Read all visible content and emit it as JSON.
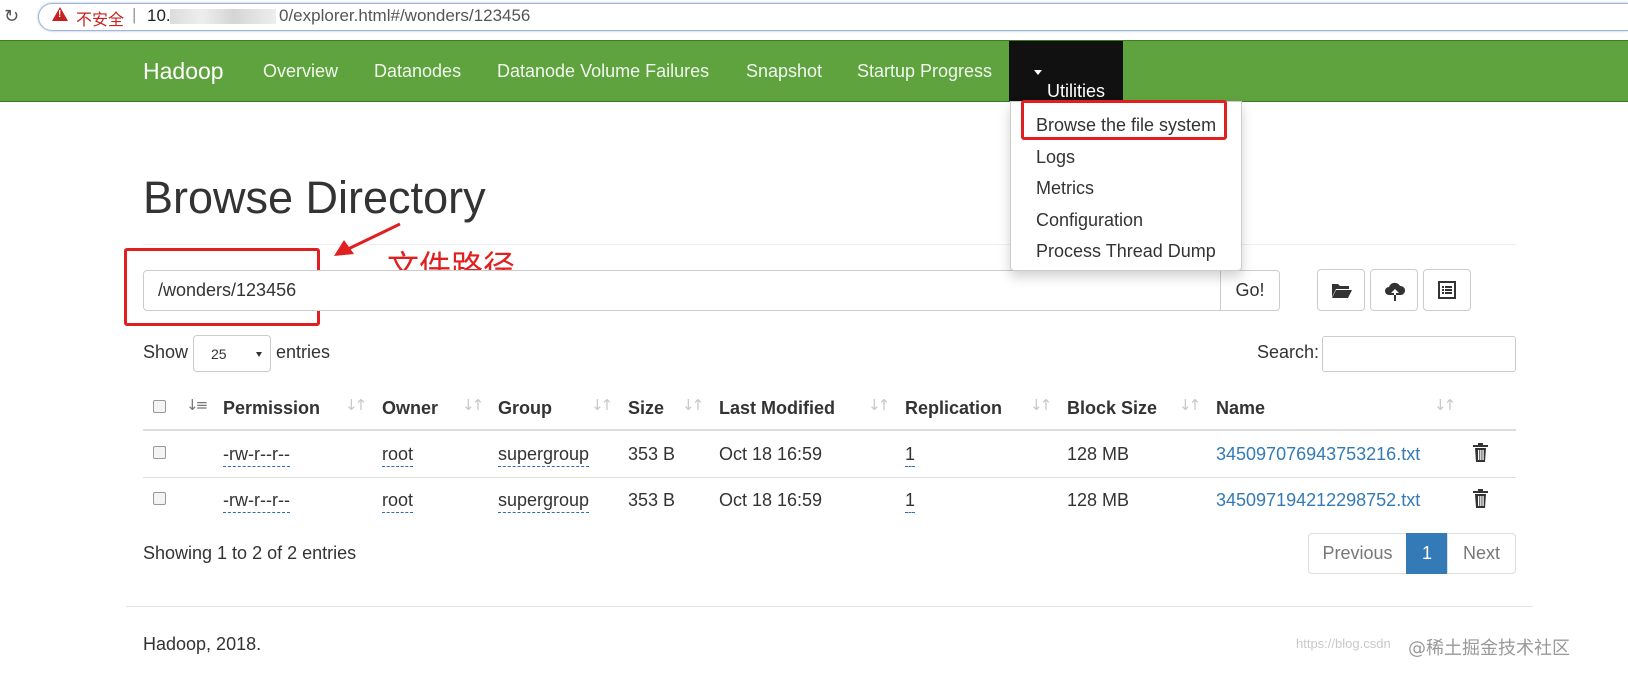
{
  "browser": {
    "insecure_label": "不安全",
    "separator": "|",
    "url_prefix": "10.",
    "url_suffix": "0/explorer.html#/wonders/123456"
  },
  "navbar": {
    "brand": "Hadoop",
    "links": [
      "Overview",
      "Datanodes",
      "Datanode Volume Failures",
      "Snapshot",
      "Startup Progress"
    ],
    "active": "Utilities",
    "bg_color": "#5fa33e"
  },
  "dropdown": {
    "items": [
      "Browse the file system",
      "Logs",
      "Metrics",
      "Configuration",
      "Process Thread Dump"
    ]
  },
  "page": {
    "title": "Browse Directory",
    "annotation": "文件路径",
    "path_value": "/wonders/123456",
    "go_label": "Go!",
    "show_label": "Show",
    "entries_select": "25",
    "entries_label": "entries",
    "search_label": "Search:"
  },
  "table": {
    "columns": [
      "Permission",
      "Owner",
      "Group",
      "Size",
      "Last Modified",
      "Replication",
      "Block Size",
      "Name"
    ],
    "rows": [
      {
        "permission": "-rw-r--r--",
        "owner": "root",
        "group": "supergroup",
        "size": "353 B",
        "modified": "Oct 18 16:59",
        "replication": "1",
        "block_size": "128 MB",
        "name": "345097076943753216.txt"
      },
      {
        "permission": "-rw-r--r--",
        "owner": "root",
        "group": "supergroup",
        "size": "353 B",
        "modified": "Oct 18 16:59",
        "replication": "1",
        "block_size": "128 MB",
        "name": "345097194212298752.txt"
      }
    ]
  },
  "pagination": {
    "summary": "Showing 1 to 2 of 2 entries",
    "previous": "Previous",
    "current": "1",
    "next": "Next"
  },
  "footer": {
    "text": "Hadoop, 2018."
  },
  "watermark": {
    "faint": "https://blog.csdn",
    "credit": "@稀土掘金技术社区"
  }
}
